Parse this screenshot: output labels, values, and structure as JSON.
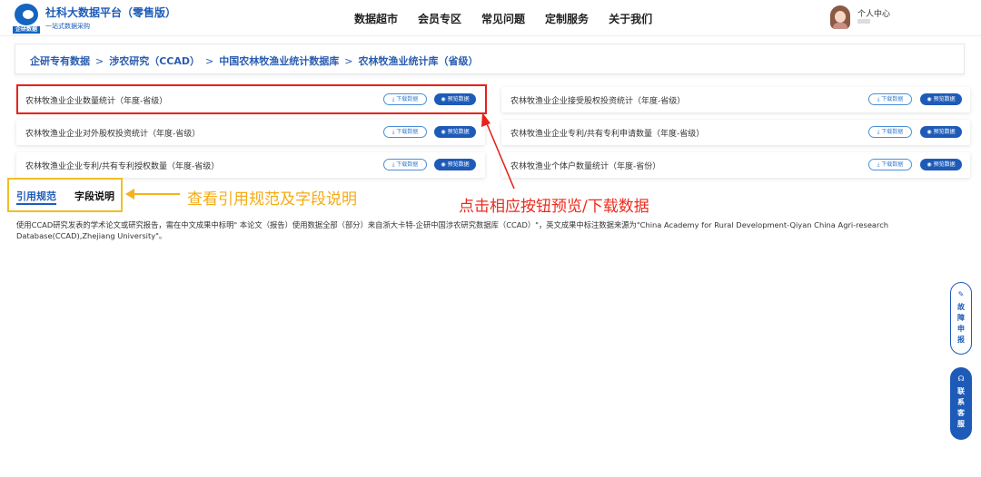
{
  "header": {
    "brand_title": "社科大数据平台（零售版）",
    "brand_subtitle": "一站式数据采购",
    "logo_tag": "企研数据",
    "nav": [
      "数据超市",
      "会员专区",
      "常见问题",
      "定制服务",
      "关于我们"
    ],
    "user_center": "个人中心"
  },
  "breadcrumb": [
    "企研专有数据",
    "涉农研究（CCAD）",
    "中国农林牧渔业统计数据库",
    "农林牧渔业统计库（省级）"
  ],
  "breadcrumb_sep": ">",
  "datasets": [
    {
      "label": "农林牧渔业企业数量统计（年度-省级）"
    },
    {
      "label": "农林牧渔业企业接受股权投资统计（年度-省级）"
    },
    {
      "label": "农林牧渔业企业对外股权投资统计（年度-省级）"
    },
    {
      "label": "农林牧渔业企业专利/共有专利申请数量（年度-省级）"
    },
    {
      "label": "农林牧渔业企业专利/共有专利授权数量（年度-省级）"
    },
    {
      "label": "农林牧渔业个体户数量统计（年度-省份）"
    }
  ],
  "buttons": {
    "download": "⤓ 下载数据",
    "preview": "◉ 预览数据"
  },
  "tabs": {
    "citation": "引用规范",
    "fields": "字段说明"
  },
  "annotations": {
    "tabs_hint": "查看引用规范及字段说明",
    "buttons_hint": "点击相应按钮预览/下载数据"
  },
  "citation_text": "使用CCAD研究发表的学术论文或研究报告，需在中文成果中标明\" 本论文（报告）使用数据全部（部分）来自浙大卡特-企研中国涉农研究数据库（CCAD）\"，英文成果中标注数据来源为\"China Academy for Rural Development-Qiyan China Agri-research Database(CCAD),Zhejiang University\"。",
  "float_buttons": {
    "report_icon": "✎",
    "report": "故障申报",
    "service_icon": "☊",
    "service": "联系客服"
  },
  "colors": {
    "brand_blue": "#1e5bb8",
    "highlight_red": "#e8221b",
    "highlight_yellow": "#f2be22"
  }
}
